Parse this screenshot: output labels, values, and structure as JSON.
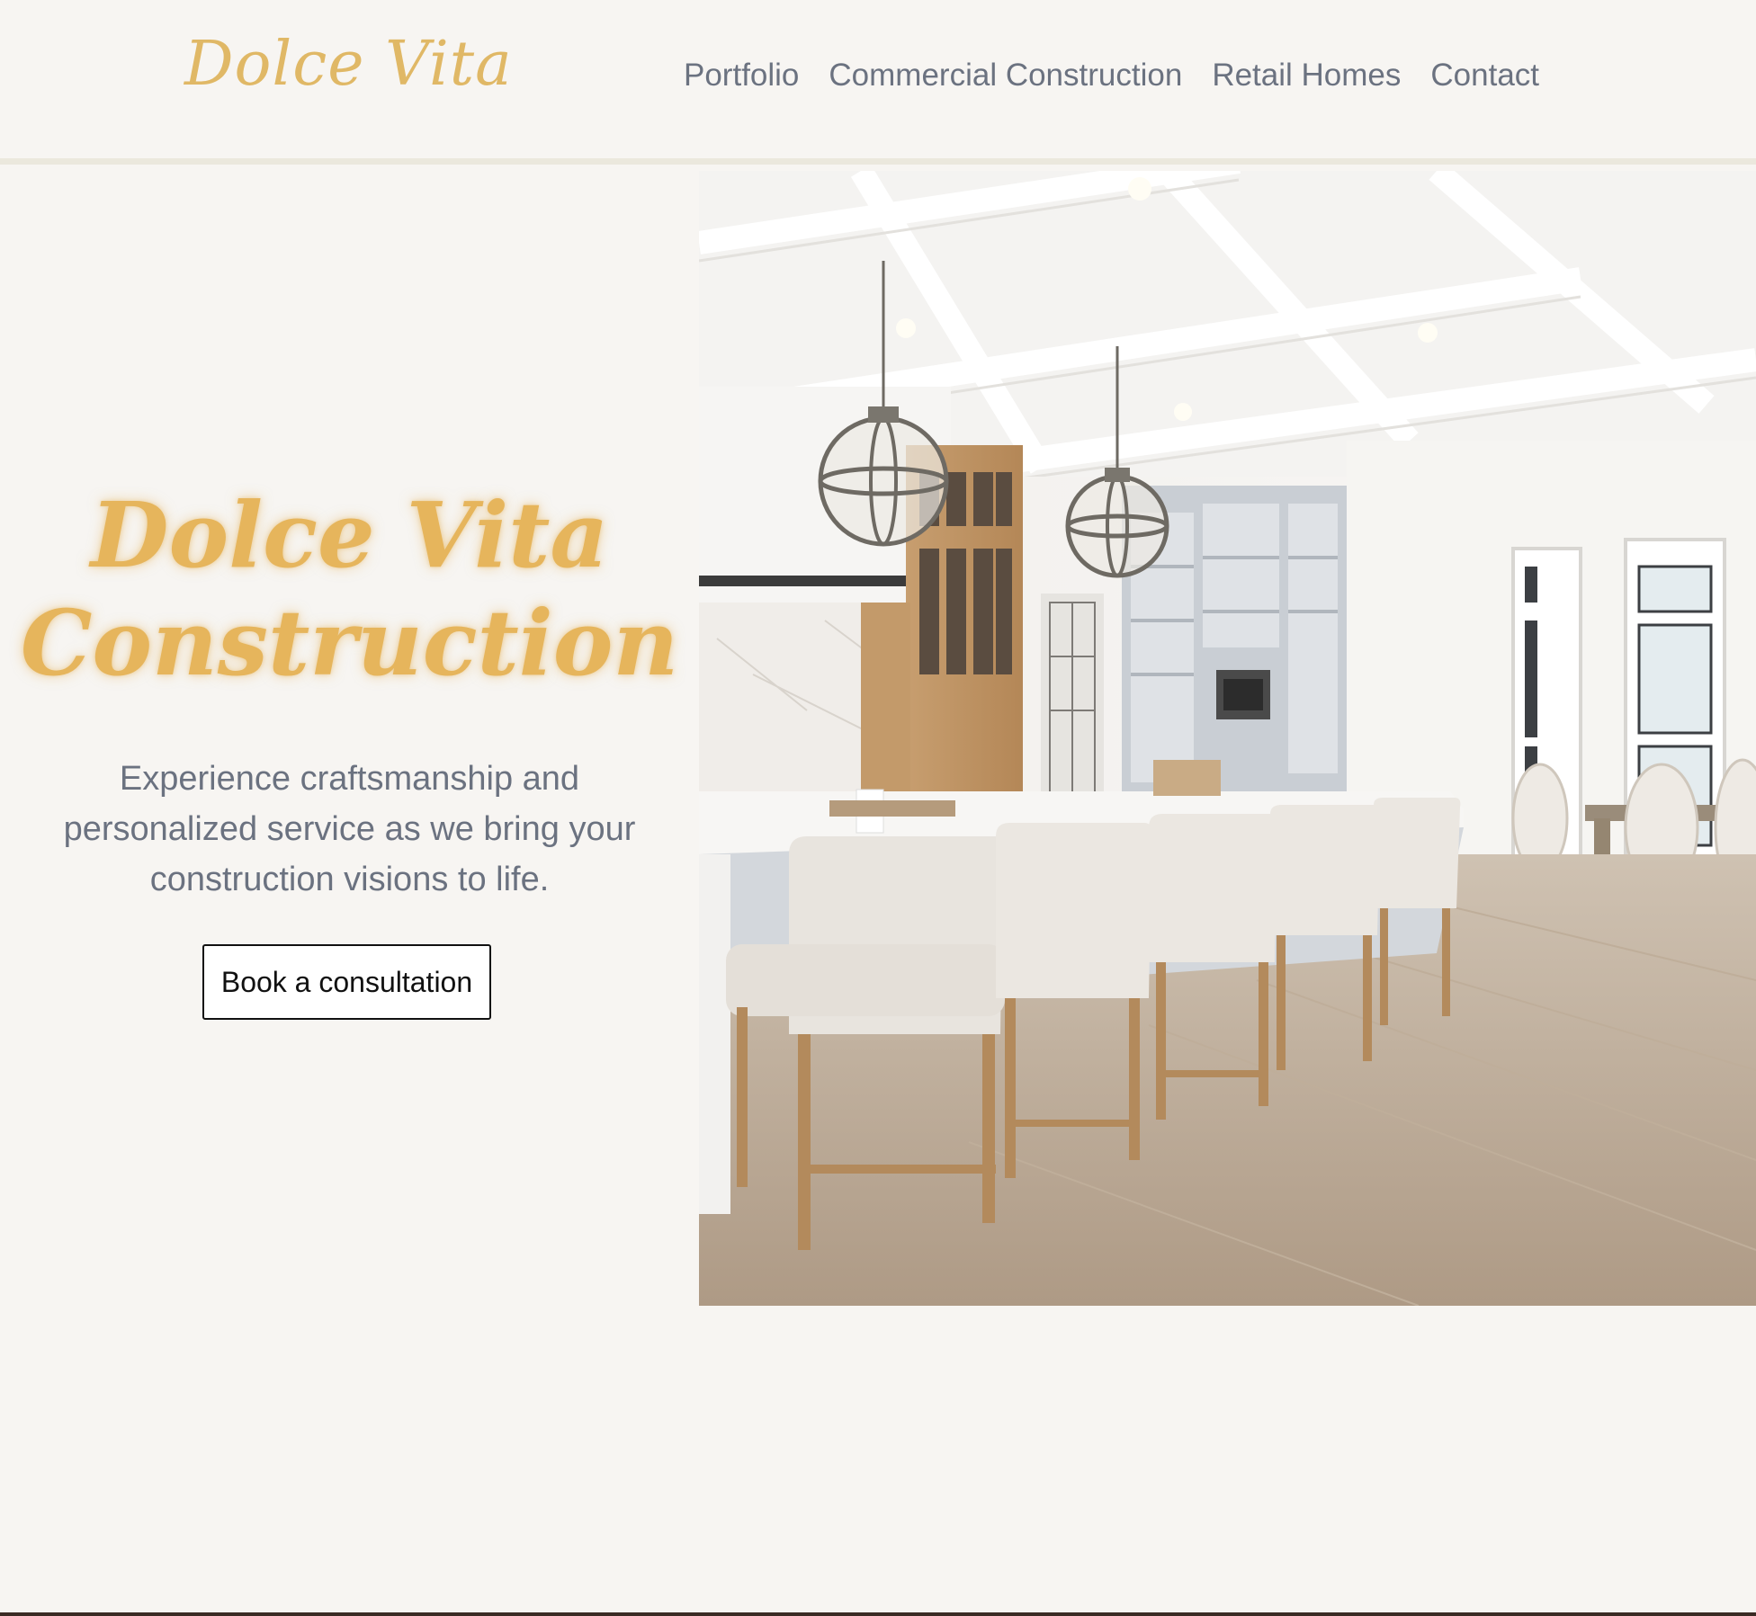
{
  "header": {
    "logo": "Dolce Vita",
    "nav": [
      {
        "label": "Portfolio"
      },
      {
        "label": "Commercial Construction"
      },
      {
        "label": "Retail Homes"
      },
      {
        "label": "Contact"
      }
    ]
  },
  "hero": {
    "title_line1": "Dolce Vita",
    "title_line2": "Construction",
    "subtitle": "Experience craftsmanship and personalized service as we bring your construction visions to life.",
    "cta_label": "Book a consultation",
    "image_alt": "Bright white kitchen with island, pendant lights and bar stools"
  },
  "colors": {
    "background": "#f7f5f2",
    "accent_gold": "#e6b55c",
    "nav_text": "#6b7280"
  }
}
